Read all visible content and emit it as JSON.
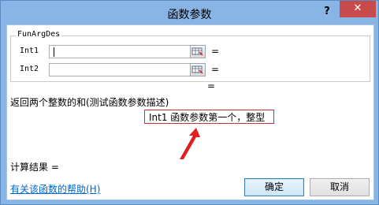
{
  "window": {
    "title": "函数参数",
    "help_glyph": "?",
    "close_glyph": "✕"
  },
  "group": {
    "label": "FunArgDes"
  },
  "args": [
    {
      "label": "Int1",
      "value": "",
      "equals": "="
    },
    {
      "label": "Int2",
      "value": "",
      "equals": "="
    }
  ],
  "formula_result_equals": "=",
  "description": "返回两个整数的和(测试函数参数描述)",
  "param_description": "Int1  函数参数第一个，整型",
  "result": {
    "label": "计算结果 ="
  },
  "help_link": "有关该函数的帮助(H)",
  "buttons": {
    "ok": "确定",
    "cancel": "取消"
  },
  "colors": {
    "titlebar": "#88b4e6",
    "close_button": "#c74b4b",
    "highlight_border": "#d23030",
    "annotation_arrow": "#e02020",
    "link": "#0066cc"
  },
  "icons": {
    "ref_button": "range-select-icon",
    "annotation": "red-arrow-icon"
  }
}
